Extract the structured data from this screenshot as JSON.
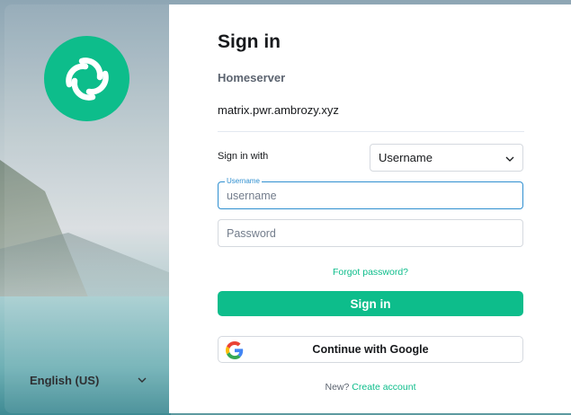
{
  "left": {
    "logo_icon": "element-logo-icon",
    "language": "English (US)",
    "chevron_icon": "chevron-down-icon"
  },
  "form": {
    "title": "Sign in",
    "homeserver_label": "Homeserver",
    "homeserver_value": "matrix.pwr.ambrozy.xyz",
    "sign_in_with_label": "Sign in with",
    "sign_in_with_value": "Username",
    "username_label": "Username",
    "username_placeholder": "username",
    "password_placeholder": "Password",
    "forgot_password": "Forgot password?",
    "sign_in_button": "Sign in",
    "google_button": "Continue with Google",
    "new_prefix": "New?",
    "create_account": "Create account"
  },
  "colors": {
    "accent": "#0dbd8b",
    "focus": "#2f8fd0",
    "text": "#17191c",
    "muted": "#5c6470"
  }
}
